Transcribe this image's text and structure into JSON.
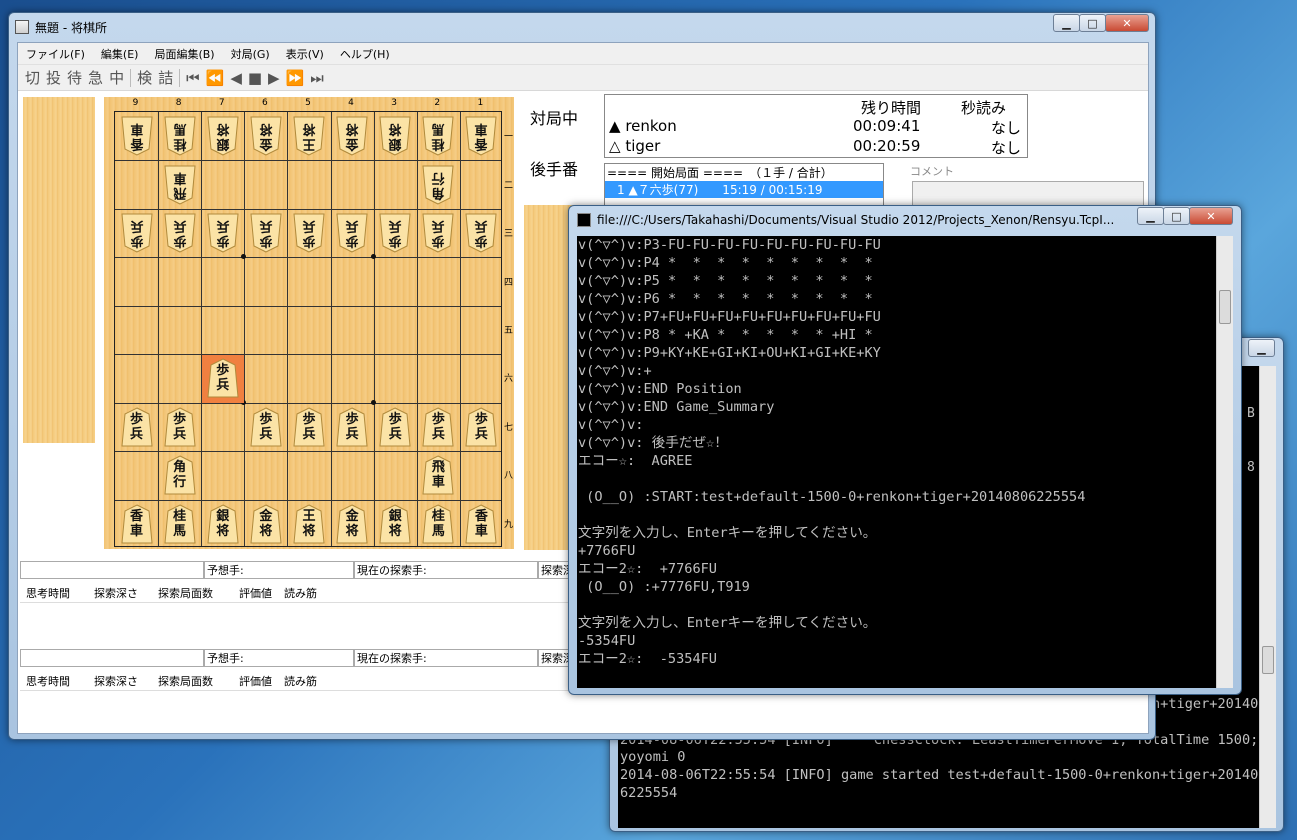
{
  "shogi_window": {
    "title": "無題 - 将棋所",
    "menu": [
      "ファイル(F)",
      "編集(E)",
      "局面編集(B)",
      "対局(G)",
      "表示(V)",
      "ヘルプ(H)"
    ],
    "toolbar": [
      "切",
      "投",
      "待",
      "急",
      "中",
      "検",
      "詰",
      "⏮",
      "⏪",
      "◀",
      "■",
      "▶",
      "⏩",
      "⏭"
    ],
    "board": {
      "col_numbers": [
        "9",
        "8",
        "7",
        "6",
        "5",
        "4",
        "3",
        "2",
        "1"
      ],
      "row_numbers": [
        "一",
        "二",
        "三",
        "四",
        "五",
        "六",
        "七",
        "八",
        "九"
      ],
      "pieces": [
        {
          "col": 9,
          "row": 1,
          "t1": "香",
          "t2": "車",
          "owner": "gote"
        },
        {
          "col": 8,
          "row": 1,
          "t1": "桂",
          "t2": "馬",
          "owner": "gote"
        },
        {
          "col": 7,
          "row": 1,
          "t1": "銀",
          "t2": "将",
          "owner": "gote"
        },
        {
          "col": 6,
          "row": 1,
          "t1": "金",
          "t2": "将",
          "owner": "gote"
        },
        {
          "col": 5,
          "row": 1,
          "t1": "王",
          "t2": "将",
          "owner": "gote"
        },
        {
          "col": 4,
          "row": 1,
          "t1": "金",
          "t2": "将",
          "owner": "gote"
        },
        {
          "col": 3,
          "row": 1,
          "t1": "銀",
          "t2": "将",
          "owner": "gote"
        },
        {
          "col": 2,
          "row": 1,
          "t1": "桂",
          "t2": "馬",
          "owner": "gote"
        },
        {
          "col": 1,
          "row": 1,
          "t1": "香",
          "t2": "車",
          "owner": "gote"
        },
        {
          "col": 8,
          "row": 2,
          "t1": "飛",
          "t2": "車",
          "owner": "gote"
        },
        {
          "col": 2,
          "row": 2,
          "t1": "角",
          "t2": "行",
          "owner": "gote"
        },
        {
          "col": 9,
          "row": 3,
          "t1": "歩",
          "t2": "兵",
          "owner": "gote"
        },
        {
          "col": 8,
          "row": 3,
          "t1": "歩",
          "t2": "兵",
          "owner": "gote"
        },
        {
          "col": 7,
          "row": 3,
          "t1": "歩",
          "t2": "兵",
          "owner": "gote"
        },
        {
          "col": 6,
          "row": 3,
          "t1": "歩",
          "t2": "兵",
          "owner": "gote"
        },
        {
          "col": 5,
          "row": 3,
          "t1": "歩",
          "t2": "兵",
          "owner": "gote"
        },
        {
          "col": 4,
          "row": 3,
          "t1": "歩",
          "t2": "兵",
          "owner": "gote"
        },
        {
          "col": 3,
          "row": 3,
          "t1": "歩",
          "t2": "兵",
          "owner": "gote"
        },
        {
          "col": 2,
          "row": 3,
          "t1": "歩",
          "t2": "兵",
          "owner": "gote"
        },
        {
          "col": 1,
          "row": 3,
          "t1": "歩",
          "t2": "兵",
          "owner": "gote"
        },
        {
          "col": 7,
          "row": 6,
          "t1": "歩",
          "t2": "兵",
          "owner": "sente"
        },
        {
          "col": 9,
          "row": 7,
          "t1": "歩",
          "t2": "兵",
          "owner": "sente"
        },
        {
          "col": 8,
          "row": 7,
          "t1": "歩",
          "t2": "兵",
          "owner": "sente"
        },
        {
          "col": 6,
          "row": 7,
          "t1": "歩",
          "t2": "兵",
          "owner": "sente"
        },
        {
          "col": 5,
          "row": 7,
          "t1": "歩",
          "t2": "兵",
          "owner": "sente"
        },
        {
          "col": 4,
          "row": 7,
          "t1": "歩",
          "t2": "兵",
          "owner": "sente"
        },
        {
          "col": 3,
          "row": 7,
          "t1": "歩",
          "t2": "兵",
          "owner": "sente"
        },
        {
          "col": 2,
          "row": 7,
          "t1": "歩",
          "t2": "兵",
          "owner": "sente"
        },
        {
          "col": 1,
          "row": 7,
          "t1": "歩",
          "t2": "兵",
          "owner": "sente"
        },
        {
          "col": 8,
          "row": 8,
          "t1": "角",
          "t2": "行",
          "owner": "sente"
        },
        {
          "col": 2,
          "row": 8,
          "t1": "飛",
          "t2": "車",
          "owner": "sente"
        },
        {
          "col": 9,
          "row": 9,
          "t1": "香",
          "t2": "車",
          "owner": "sente"
        },
        {
          "col": 8,
          "row": 9,
          "t1": "桂",
          "t2": "馬",
          "owner": "sente"
        },
        {
          "col": 7,
          "row": 9,
          "t1": "銀",
          "t2": "将",
          "owner": "sente"
        },
        {
          "col": 6,
          "row": 9,
          "t1": "金",
          "t2": "将",
          "owner": "sente"
        },
        {
          "col": 5,
          "row": 9,
          "t1": "王",
          "t2": "将",
          "owner": "sente"
        },
        {
          "col": 4,
          "row": 9,
          "t1": "金",
          "t2": "将",
          "owner": "sente"
        },
        {
          "col": 3,
          "row": 9,
          "t1": "銀",
          "t2": "将",
          "owner": "sente"
        },
        {
          "col": 2,
          "row": 9,
          "t1": "桂",
          "t2": "馬",
          "owner": "sente"
        },
        {
          "col": 1,
          "row": 9,
          "t1": "香",
          "t2": "車",
          "owner": "sente"
        }
      ],
      "last_move": {
        "col": 7,
        "row": 6
      }
    },
    "game_state": "対局中",
    "turn_state": "後手番",
    "clock": {
      "header_remaining": "残り時間",
      "header_byoyomi": "秒読み",
      "players": [
        {
          "mark": "▲",
          "name": "renkon",
          "time": "00:09:41",
          "byoyomi": "なし"
        },
        {
          "mark": "△",
          "name": "tiger",
          "time": "00:20:59",
          "byoyomi": "なし"
        }
      ]
    },
    "kifu": {
      "header": "==== 開始局面 ====　（１手 / 合計）",
      "moves": [
        "　1 ▲７六歩(77)　　15:19 / 00:15:19"
      ]
    },
    "comment_label": "コメント",
    "engine_panels": [
      {
        "predicted": "予想手:",
        "current": "現在の探索手:",
        "search": "探索深",
        "cols": [
          "思考時間",
          "探索深さ",
          "探索局面数",
          "評価値",
          "読み筋"
        ]
      },
      {
        "predicted": "予想手:",
        "current": "現在の探索手:",
        "search": "探索深",
        "cols": [
          "思考時間",
          "探索深さ",
          "探索局面数",
          "評価値",
          "読み筋"
        ]
      }
    ]
  },
  "console_front": {
    "title": "file:///C:/Users/Takahashi/Documents/Visual Studio 2012/Projects_Xenon/Rensyu.TcpI...",
    "lines": [
      "v(^▽^)v:P3-FU-FU-FU-FU-FU-FU-FU-FU-FU",
      "v(^▽^)v:P4 *  *  *  *  *  *  *  *  *",
      "v(^▽^)v:P5 *  *  *  *  *  *  *  *  *",
      "v(^▽^)v:P6 *  *  *  *  *  *  *  *  *",
      "v(^▽^)v:P7+FU+FU+FU+FU+FU+FU+FU+FU+FU",
      "v(^▽^)v:P8 * +KA *  *  *  *  * +HI *",
      "v(^▽^)v:P9+KY+KE+GI+KI+OU+KI+GI+KE+KY",
      "v(^▽^)v:+",
      "v(^▽^)v:END Position",
      "v(^▽^)v:END Game_Summary",
      "v(^▽^)v:",
      "v(^▽^)v: 後手だぜ☆！",
      "エコー☆:  AGREE",
      "",
      " (O__O) :START:test+default-1500-0+renkon+tiger+20140806225554",
      "",
      "文字列を入力し、Enterキーを押してください。",
      "+7766FU",
      "エコー2☆:  +7766FU",
      " (O__O) :+7776FU,T919",
      "",
      "文字列を入力し、Enterキーを押してください。",
      "-5354FU",
      "エコー2☆:  -5354FU"
    ]
  },
  "console_back": {
    "right_chars": [
      "B",
      "8"
    ],
    "lines": [
      "2014-08-06T22:55:54 [INFO] game created test+default-1500-0+renkon+tiger+2014080",
      "6225554",
      "2014-08-06T22:55:54 [INFO]     ChessClock: LeastTimePerMove 1; TotalTime 1500; B",
      "yoyomi 0",
      "2014-08-06T22:55:54 [INFO] game started test+default-1500-0+renkon+tiger+2014080",
      "6225554"
    ]
  }
}
